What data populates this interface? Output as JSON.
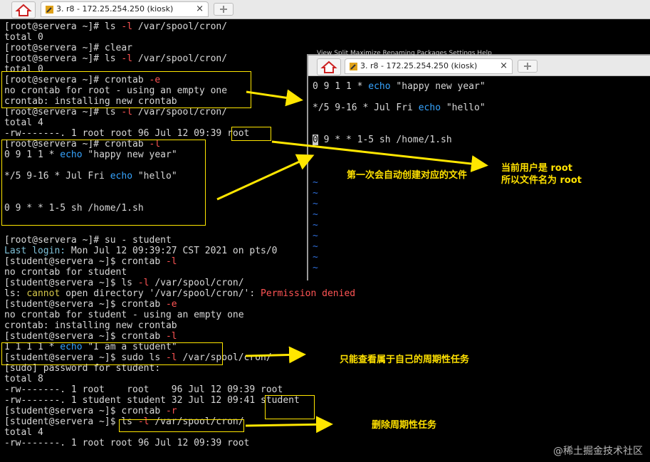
{
  "main_window": {
    "tab_title": "3. r8 - 172.25.254.250 (kiosk)",
    "lines": [
      [
        {
          "t": "[root@servera ~]# ls "
        },
        {
          "t": "-l",
          "c": "red"
        },
        {
          "t": " /var/spool/cron/"
        }
      ],
      [
        {
          "t": "total 0"
        }
      ],
      [
        {
          "t": "[root@servera ~]# clear"
        }
      ],
      [
        {
          "t": "[root@servera ~]# ls "
        },
        {
          "t": "-l",
          "c": "red"
        },
        {
          "t": " /var/spool/cron/"
        }
      ],
      [
        {
          "t": "total 0"
        }
      ],
      [
        {
          "t": "[root@servera ~]# crontab "
        },
        {
          "t": "-e",
          "c": "red"
        }
      ],
      [
        {
          "t": "no crontab for root - using an empty one"
        }
      ],
      [
        {
          "t": "crontab: installing new crontab"
        }
      ],
      [
        {
          "t": "[root@servera ~]# ls "
        },
        {
          "t": "-l",
          "c": "red"
        },
        {
          "t": " /var/spool/cron/"
        }
      ],
      [
        {
          "t": "total 4"
        }
      ],
      [
        {
          "t": "-rw-------. 1 root root 96 Jul 12 09:39 root"
        }
      ],
      [
        {
          "t": "[root@servera ~]# crontab "
        },
        {
          "t": "-l",
          "c": "red"
        }
      ],
      [
        {
          "t": "0 9 1 1 * "
        },
        {
          "t": "echo",
          "c": "blue"
        },
        {
          "t": " \"happy new year\""
        }
      ],
      [
        {
          "t": ""
        }
      ],
      [
        {
          "t": "*/5 9-16 * Jul Fri "
        },
        {
          "t": "echo",
          "c": "blue"
        },
        {
          "t": " \"hello\""
        }
      ],
      [
        {
          "t": ""
        }
      ],
      [
        {
          "t": ""
        }
      ],
      [
        {
          "t": "0 9 * * 1-5 sh /home/1.sh"
        }
      ],
      [
        {
          "t": ""
        }
      ],
      [
        {
          "t": ""
        }
      ],
      [
        {
          "t": "[root@servera ~]# su - student"
        }
      ],
      [
        {
          "t": "Last login:",
          "c": "cyan"
        },
        {
          "t": " Mon Jul 12 09:39:27 CST 2021 on pts/0"
        }
      ],
      [
        {
          "t": "[student@servera ~]$ crontab "
        },
        {
          "t": "-l",
          "c": "red"
        }
      ],
      [
        {
          "t": "no crontab for student"
        }
      ],
      [
        {
          "t": "[student@servera ~]$ ls "
        },
        {
          "t": "-l",
          "c": "red"
        },
        {
          "t": " /var/spool/cron/"
        }
      ],
      [
        {
          "t": "ls: "
        },
        {
          "t": "cannot",
          "c": "yellow"
        },
        {
          "t": " open directory '/var/spool/cron/': "
        },
        {
          "t": "Permission denied",
          "c": "red"
        }
      ],
      [
        {
          "t": "[student@servera ~]$ crontab "
        },
        {
          "t": "-e",
          "c": "red"
        }
      ],
      [
        {
          "t": "no crontab for student - using an empty one"
        }
      ],
      [
        {
          "t": "crontab: installing new crontab"
        }
      ],
      [
        {
          "t": "[student@servera ~]$ crontab "
        },
        {
          "t": "-l",
          "c": "red"
        }
      ],
      [
        {
          "t": "1 1 1 1 * "
        },
        {
          "t": "echo",
          "c": "blue"
        },
        {
          "t": " \"I am a student\""
        }
      ],
      [
        {
          "t": "[student@servera ~]$ sudo ls "
        },
        {
          "t": "-l",
          "c": "red"
        },
        {
          "t": " /var/spool/cron/"
        }
      ],
      [
        {
          "t": "[sudo] password for student:"
        }
      ],
      [
        {
          "t": "total 8"
        }
      ],
      [
        {
          "t": "-rw-------. 1 root    root    96 Jul 12 09:39 root"
        }
      ],
      [
        {
          "t": "-rw-------. 1 student student 32 Jul 12 09:41 student"
        }
      ],
      [
        {
          "t": "[student@servera ~]$ crontab "
        },
        {
          "t": "-r",
          "c": "red"
        }
      ],
      [
        {
          "t": "[student@servera ~]$ ls "
        },
        {
          "t": "-l",
          "c": "red"
        },
        {
          "t": " /var/spool/cron/"
        }
      ],
      [
        {
          "t": "total 4"
        }
      ],
      [
        {
          "t": "-rw-------. 1 root root 96 Jul 12 09:39 root"
        }
      ]
    ]
  },
  "overlay_window": {
    "tab_title": "3. r8 - 172.25.254.250 (kiosk)",
    "menu_remnant": "View    Split    Maximize   Renaming   Packages   Settings    Help",
    "lines": [
      [
        {
          "t": "0 9 1 1 * "
        },
        {
          "t": "echo",
          "c": "blue"
        },
        {
          "t": " \"happy new year\""
        }
      ],
      [
        {
          "t": ""
        }
      ],
      [
        {
          "t": "*/5 9-16 * Jul Fri "
        },
        {
          "t": "echo",
          "c": "blue"
        },
        {
          "t": " \"hello\""
        }
      ],
      [
        {
          "t": ""
        }
      ],
      [
        {
          "t": ""
        }
      ],
      [
        {
          "t": "0",
          "c": "cursor"
        },
        {
          "t": " 9 * * 1-5 sh /home/1.sh"
        }
      ],
      [
        {
          "t": ""
        }
      ],
      [
        {
          "t": ""
        }
      ],
      [
        {
          "t": ""
        }
      ],
      [
        {
          "t": "~",
          "c": "tilde"
        }
      ],
      [
        {
          "t": "~",
          "c": "tilde"
        }
      ],
      [
        {
          "t": "~",
          "c": "tilde"
        }
      ],
      [
        {
          "t": "~",
          "c": "tilde"
        }
      ],
      [
        {
          "t": "~",
          "c": "tilde"
        }
      ],
      [
        {
          "t": "~",
          "c": "tilde"
        }
      ],
      [
        {
          "t": "~",
          "c": "tilde"
        }
      ],
      [
        {
          "t": "~",
          "c": "tilde"
        }
      ],
      [
        {
          "t": "~",
          "c": "tilde"
        }
      ]
    ]
  },
  "annotations": {
    "auto_create": "第一次会自动创建对应的文件",
    "current_user": "当前用户是 root\n所以文件名为 root",
    "own_only": "只能查看属于自己的周期性任务",
    "delete_task": "删除周期性任务"
  },
  "watermark": "@稀土掘金技术社区",
  "colors": {
    "terminal_bg": "#000000",
    "terminal_fg": "#d8d8d8",
    "flag_red": "#ff5454",
    "command_blue": "#36a4ff",
    "annotation_yellow": "#ffe100"
  }
}
